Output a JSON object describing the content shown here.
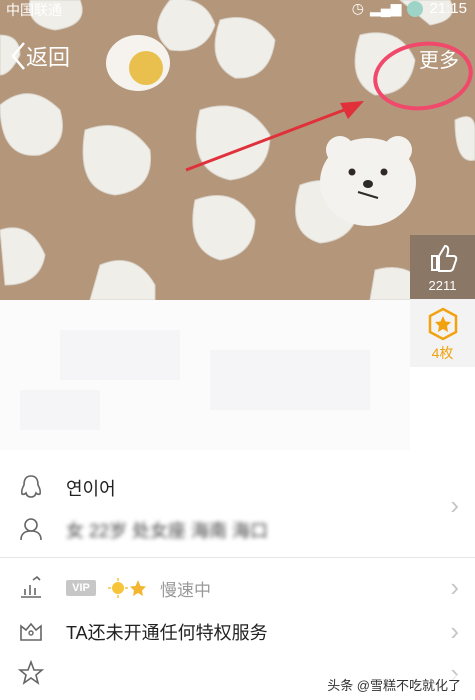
{
  "status_bar": {
    "carrier": "中国联通",
    "time": "21:15"
  },
  "nav": {
    "back_label": "返回",
    "more_label": "更多"
  },
  "side": {
    "like_count": "2211",
    "badge_count": "4枚"
  },
  "profile": {
    "name": "연이어",
    "info": "女 22岁 处女座 海南 海口"
  },
  "rows": {
    "vip_status": "慢速中",
    "vip_badge": "VIP",
    "privilege": "TA还未开通任何特权服务"
  },
  "colors": {
    "header_bg": "#b4967a",
    "highlight": "#f0496b",
    "arrow": "#e0303a",
    "star": "#f2a20f"
  },
  "watermark": "头条 @雪糕不吃就化了"
}
